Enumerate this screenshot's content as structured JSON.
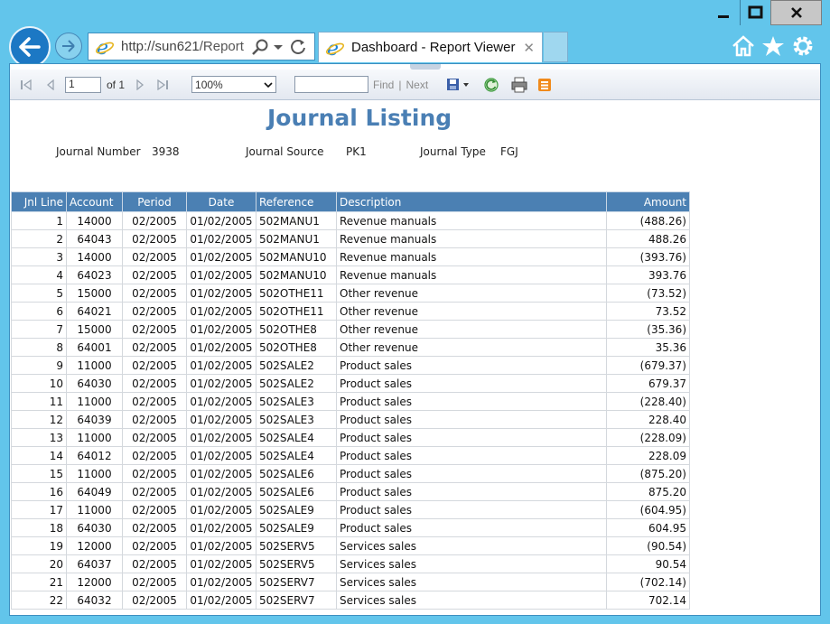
{
  "browser": {
    "url_prefix": "http://",
    "url_host": "sun621",
    "url_path": "/Report",
    "tab_title": "Dashboard - Report Viewer",
    "tab_close": "✕"
  },
  "toolbar": {
    "page_value": "1",
    "page_of": "of 1",
    "zoom_value": "100%",
    "find_label": "Find",
    "separator": "|",
    "next_label": "Next"
  },
  "report": {
    "title": "Journal Listing",
    "journal_number_label": "Journal Number",
    "journal_number_value": "3938",
    "journal_source_label": "Journal Source",
    "journal_source_value": "PK1",
    "journal_type_label": "Journal Type",
    "journal_type_value": "FGJ",
    "columns": [
      "Jnl Line",
      "Account",
      "Period",
      "Date",
      "Reference",
      "Description",
      "Amount"
    ],
    "rows": [
      [
        "1",
        "14000",
        "02/2005",
        "01/02/2005",
        "502MANU1",
        "Revenue manuals",
        "(488.26)"
      ],
      [
        "2",
        "64043",
        "02/2005",
        "01/02/2005",
        "502MANU1",
        "Revenue manuals",
        "488.26"
      ],
      [
        "3",
        "14000",
        "02/2005",
        "01/02/2005",
        "502MANU10",
        "Revenue manuals",
        "(393.76)"
      ],
      [
        "4",
        "64023",
        "02/2005",
        "01/02/2005",
        "502MANU10",
        "Revenue manuals",
        "393.76"
      ],
      [
        "5",
        "15000",
        "02/2005",
        "01/02/2005",
        "502OTHE11",
        "Other revenue",
        "(73.52)"
      ],
      [
        "6",
        "64021",
        "02/2005",
        "01/02/2005",
        "502OTHE11",
        "Other revenue",
        "73.52"
      ],
      [
        "7",
        "15000",
        "02/2005",
        "01/02/2005",
        "502OTHE8",
        "Other revenue",
        "(35.36)"
      ],
      [
        "8",
        "64001",
        "02/2005",
        "01/02/2005",
        "502OTHE8",
        "Other revenue",
        "35.36"
      ],
      [
        "9",
        "11000",
        "02/2005",
        "01/02/2005",
        "502SALE2",
        "Product sales",
        "(679.37)"
      ],
      [
        "10",
        "64030",
        "02/2005",
        "01/02/2005",
        "502SALE2",
        "Product sales",
        "679.37"
      ],
      [
        "11",
        "11000",
        "02/2005",
        "01/02/2005",
        "502SALE3",
        "Product sales",
        "(228.40)"
      ],
      [
        "12",
        "64039",
        "02/2005",
        "01/02/2005",
        "502SALE3",
        "Product sales",
        "228.40"
      ],
      [
        "13",
        "11000",
        "02/2005",
        "01/02/2005",
        "502SALE4",
        "Product sales",
        "(228.09)"
      ],
      [
        "14",
        "64012",
        "02/2005",
        "01/02/2005",
        "502SALE4",
        "Product sales",
        "228.09"
      ],
      [
        "15",
        "11000",
        "02/2005",
        "01/02/2005",
        "502SALE6",
        "Product sales",
        "(875.20)"
      ],
      [
        "16",
        "64049",
        "02/2005",
        "01/02/2005",
        "502SALE6",
        "Product sales",
        "875.20"
      ],
      [
        "17",
        "11000",
        "02/2005",
        "01/02/2005",
        "502SALE9",
        "Product sales",
        "(604.95)"
      ],
      [
        "18",
        "64030",
        "02/2005",
        "01/02/2005",
        "502SALE9",
        "Product sales",
        "604.95"
      ],
      [
        "19",
        "12000",
        "02/2005",
        "01/02/2005",
        "502SERV5",
        "Services sales",
        "(90.54)"
      ],
      [
        "20",
        "64037",
        "02/2005",
        "01/02/2005",
        "502SERV5",
        "Services sales",
        "90.54"
      ],
      [
        "21",
        "12000",
        "02/2005",
        "01/02/2005",
        "502SERV7",
        "Services sales",
        "(702.14)"
      ],
      [
        "22",
        "64032",
        "02/2005",
        "01/02/2005",
        "502SERV7",
        "Services sales",
        "702.14"
      ]
    ]
  },
  "icons": [
    "minimize-icon",
    "maximize-icon",
    "close-icon",
    "back-arrow-icon",
    "forward-arrow-icon",
    "ie-logo-icon",
    "search-icon",
    "dropdown-icon",
    "refresh-icon",
    "home-icon",
    "favorites-star-icon",
    "settings-gear-icon",
    "first-page-icon",
    "previous-page-icon",
    "next-page-icon",
    "last-page-icon",
    "export-save-icon",
    "report-refresh-icon",
    "print-icon",
    "data-feed-icon"
  ],
  "colors": {
    "frame": "#62c5eb",
    "header": "#4b80b3",
    "title": "#4a7fb4"
  }
}
